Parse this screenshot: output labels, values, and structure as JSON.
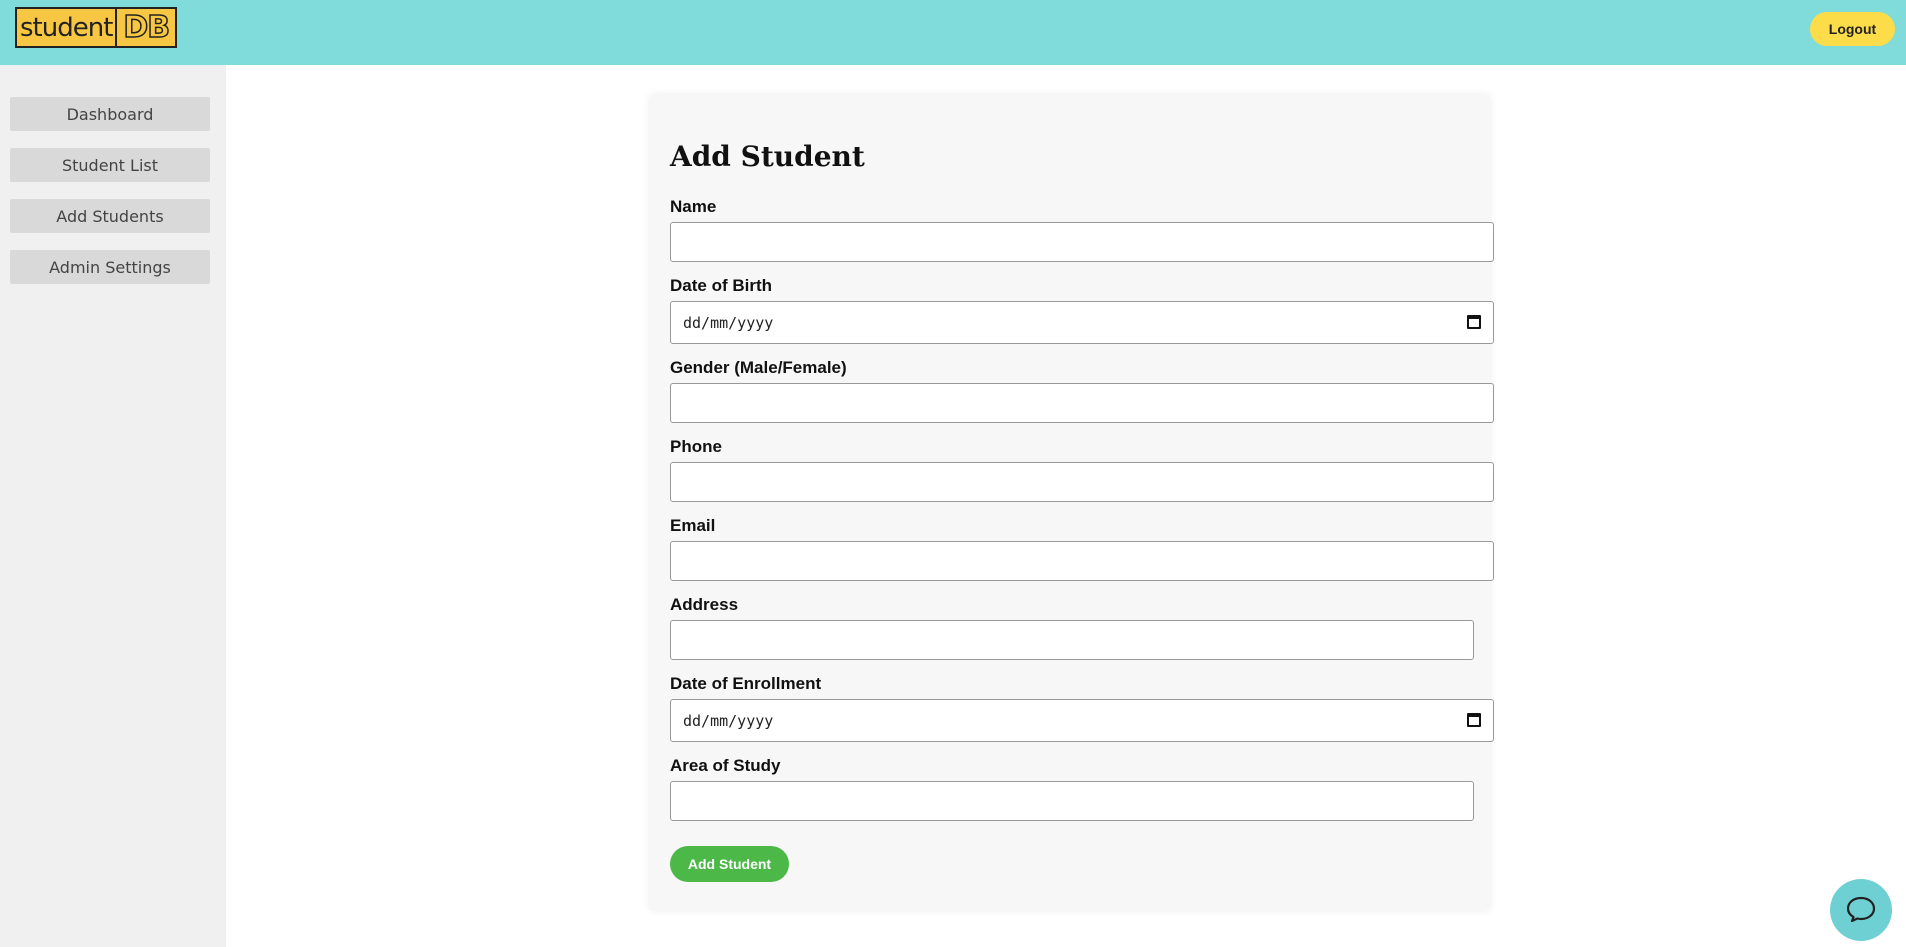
{
  "header": {
    "logo_left": "student",
    "logo_right": "DB",
    "logout_label": "Logout"
  },
  "sidebar": {
    "items": [
      {
        "label": "Dashboard"
      },
      {
        "label": "Student List"
      },
      {
        "label": "Add Students"
      },
      {
        "label": "Admin Settings"
      }
    ]
  },
  "form": {
    "title": "Add Student",
    "fields": [
      {
        "label": "Name",
        "value": ""
      },
      {
        "label": "Date of Birth",
        "placeholder": "dd/mm/yyyy"
      },
      {
        "label": "Gender (Male/Female)",
        "value": ""
      },
      {
        "label": "Phone",
        "value": ""
      },
      {
        "label": "Email",
        "value": ""
      },
      {
        "label": "Address",
        "value": ""
      },
      {
        "label": "Date of Enrollment",
        "placeholder": "dd/mm/yyyy"
      },
      {
        "label": "Area of Study",
        "value": ""
      }
    ],
    "submit_label": "Add Student"
  },
  "colors": {
    "header_bg": "#80dcdb",
    "logout_bg": "#fddc4a",
    "submit_bg": "#4cb848",
    "sidebar_bg": "#f0f0f0",
    "chat_bg": "#6fd0d3"
  },
  "icons": {
    "calendar": "calendar-icon",
    "chat": "chat-icon"
  }
}
